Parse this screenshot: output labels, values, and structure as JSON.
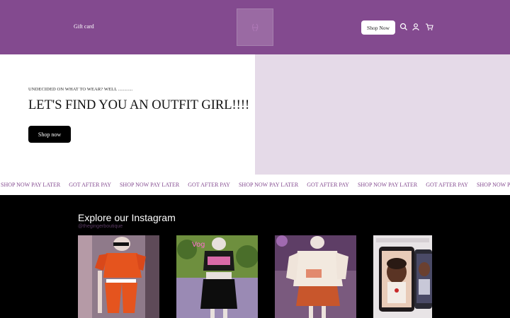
{
  "header": {
    "gift_card": "Gift card",
    "shop_now": "Shop Now",
    "icons": [
      "search-icon",
      "account-icon",
      "cart-icon"
    ],
    "brand_color": "#834a8f"
  },
  "hero": {
    "eyebrow": "UNDECIDED ON WHAT TO WEAR? WELL ............",
    "headline": "LET'S FIND YOU AN OUTFIT GIRL!!!!",
    "button": "Shop now",
    "image_bg": "#e5dae8"
  },
  "marquee": {
    "items": [
      "SHOP NOW PAY LATER",
      "GOT AFTER PAY",
      "SHOP NOW PAY LATER",
      "GOT AFTER PAY",
      "SHOP NOW PAY LATER",
      "GOT AFTER PAY",
      "SHOP NOW PAY LATER",
      "GOT AFTER PAY",
      "SHOP NOW PAY LATER"
    ]
  },
  "instagram": {
    "title": "Explore our Instagram",
    "handle": "@thegingerboutique"
  }
}
